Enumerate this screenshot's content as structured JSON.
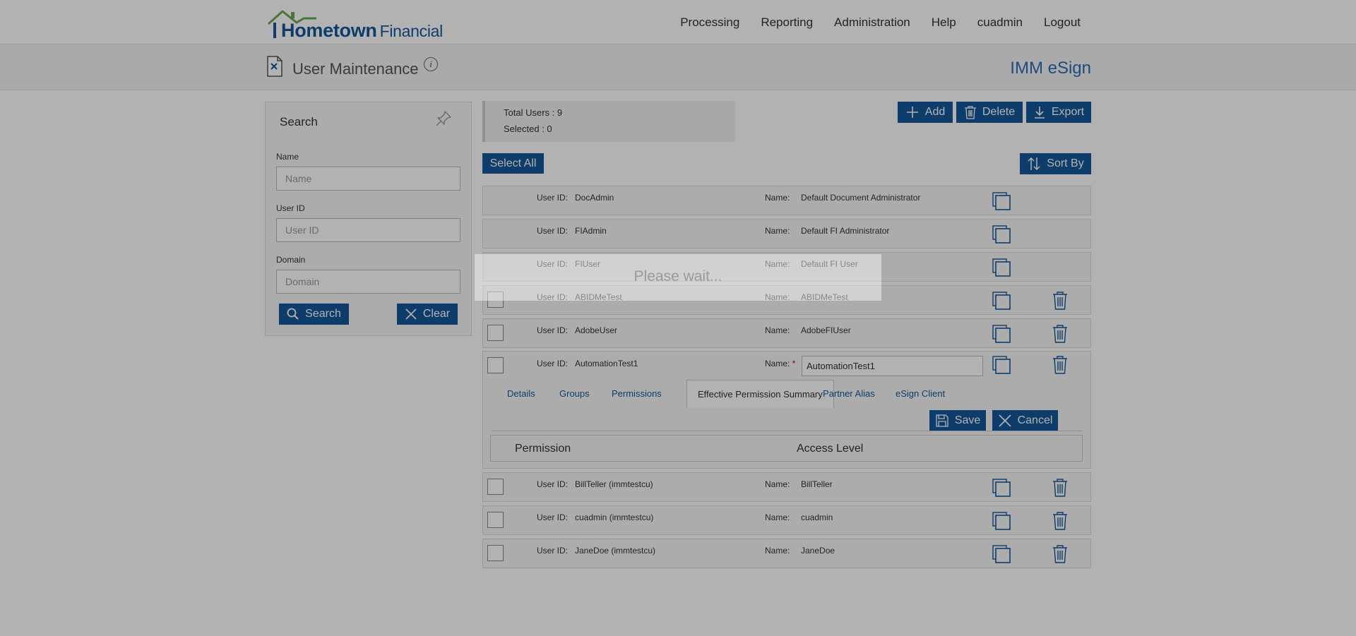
{
  "brand": {
    "name_bold": "Hometown",
    "name_light": "Financial",
    "color": "#15589a",
    "roof_color": "#6aa84f"
  },
  "nav": [
    "Processing",
    "Reporting",
    "Administration",
    "Help",
    "cuadmin",
    "Logout"
  ],
  "page": {
    "title": "User Maintenance",
    "product": "IMM eSign",
    "info_icon": "i"
  },
  "search": {
    "title": "Search",
    "name_label": "Name",
    "name_placeholder": "Name",
    "userid_label": "User ID",
    "userid_placeholder": "User ID",
    "domain_label": "Domain",
    "domain_placeholder": "Domain",
    "search_button": "Search",
    "clear_button": "Clear"
  },
  "counts": {
    "total": "Total Users : 9",
    "selected": "Selected : 0"
  },
  "toolbar": {
    "add": "Add",
    "delete": "Delete",
    "export": "Export",
    "select_all": "Select All",
    "sort_by": "Sort By"
  },
  "labels": {
    "user_id": "User ID:",
    "name": "Name:"
  },
  "users": [
    {
      "id": "DocAdmin",
      "name": "Default Document Administrator",
      "checkbox": false,
      "deletable": false
    },
    {
      "id": "FIAdmin",
      "name": "Default FI Administrator",
      "checkbox": false,
      "deletable": false
    },
    {
      "id": "FIUser",
      "name": "Default FI User",
      "checkbox": false,
      "deletable": false
    },
    {
      "id": "ABIDMeTest",
      "name": "ABIDMeTest",
      "checkbox": true,
      "deletable": true
    },
    {
      "id": "AdobeUser",
      "name": "AdobeFIUser",
      "checkbox": true,
      "deletable": true
    },
    {
      "id": "AutomationTest1",
      "name": "AutomationTest1",
      "checkbox": true,
      "deletable": true
    },
    {
      "id": "BillTeller (immtestcu)",
      "name": "BillTeller",
      "checkbox": true,
      "deletable": true
    },
    {
      "id": "cuadmin (immtestcu)",
      "name": "cuadmin",
      "checkbox": true,
      "deletable": true
    },
    {
      "id": "JaneDoe (immtestcu)",
      "name": "JaneDoe",
      "checkbox": true,
      "deletable": true
    }
  ],
  "editor": {
    "required_mark": "*",
    "tabs": [
      "Details",
      "Groups",
      "Permissions",
      "Effective Permission Summary",
      "Partner Alias",
      "eSign Client"
    ],
    "active_tab": "Effective Permission Summary",
    "save": "Save",
    "cancel": "Cancel",
    "columns": [
      "Permission",
      "Access Level"
    ]
  },
  "overlay": {
    "message": "Please wait..."
  }
}
